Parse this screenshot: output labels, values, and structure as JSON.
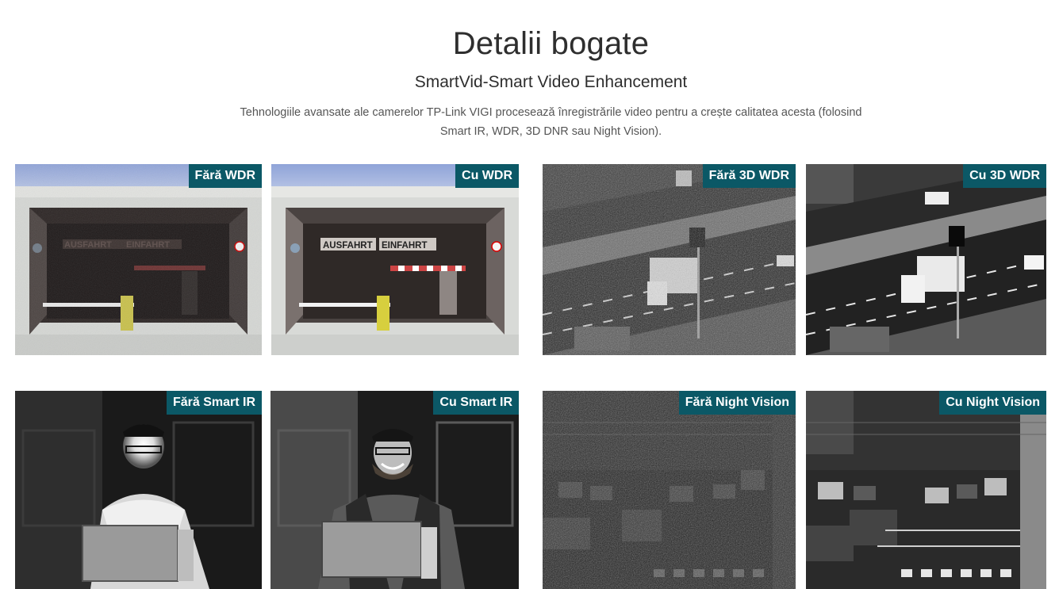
{
  "header": {
    "title": "Detalii bogate",
    "subtitle": "SmartVid-Smart Video Enhancement",
    "description": "Tehnologiile avansate ale camerelor TP-Link VIGI procesează înregistrările video pentru a crește calitatea acesta (folosind Smart IR, WDR, 3D DNR sau Night Vision)."
  },
  "comparisons": {
    "wdr": {
      "without_label": "Fără WDR",
      "with_label": "Cu WDR",
      "sign_left": "AUSFAHRT",
      "sign_right": "EINFAHRT"
    },
    "dnr": {
      "without_label": "Fără 3D WDR",
      "with_label": "Cu 3D WDR"
    },
    "ir": {
      "without_label": "Fără Smart IR",
      "with_label": "Cu Smart IR"
    },
    "night": {
      "without_label": "Fără Night Vision",
      "with_label": "Cu Night Vision"
    }
  },
  "colors": {
    "label_background": "#0b5866",
    "label_text": "#ffffff"
  }
}
